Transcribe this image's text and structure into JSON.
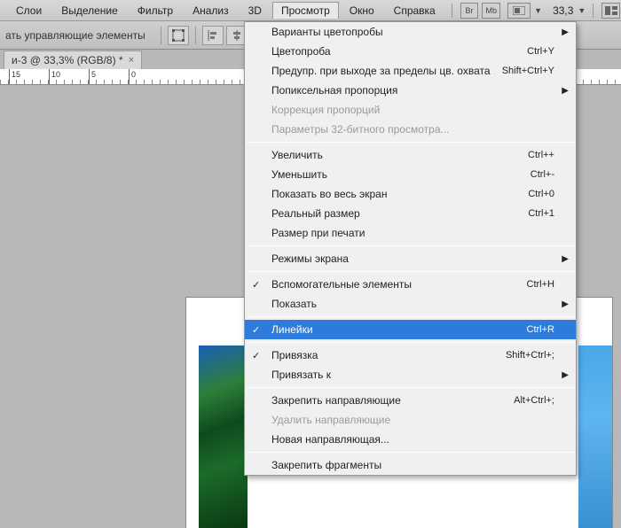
{
  "menubar": {
    "items": [
      "Слои",
      "Выделение",
      "Фильтр",
      "Анализ",
      "3D",
      "Просмотр",
      "Окно",
      "Справка"
    ],
    "open_index": 5,
    "icon_buttons": [
      "Br",
      "Mb"
    ],
    "zoom": "33,3"
  },
  "toolbar": {
    "label": "ать управляющие элементы"
  },
  "tab": {
    "title": "и-3 @ 33,3% (RGB/8) *"
  },
  "ruler": {
    "marks": [
      "15",
      "10",
      "5",
      "0"
    ]
  },
  "dropdown": {
    "groups": [
      [
        {
          "label": "Варианты цветопробы",
          "submenu": true
        },
        {
          "label": "Цветопроба",
          "shortcut": "Ctrl+Y"
        },
        {
          "label": "Предупр. при выходе за пределы цв. охвата",
          "shortcut": "Shift+Ctrl+Y"
        },
        {
          "label": "Попиксельная пропорция",
          "submenu": true
        },
        {
          "label": "Коррекция пропорций",
          "disabled": true
        },
        {
          "label": "Параметры 32-битного просмотра...",
          "disabled": true
        }
      ],
      [
        {
          "label": "Увеличить",
          "shortcut": "Ctrl++"
        },
        {
          "label": "Уменьшить",
          "shortcut": "Ctrl+-"
        },
        {
          "label": "Показать во весь экран",
          "shortcut": "Ctrl+0"
        },
        {
          "label": "Реальный размер",
          "shortcut": "Ctrl+1"
        },
        {
          "label": "Размер при печати"
        }
      ],
      [
        {
          "label": "Режимы экрана",
          "submenu": true
        }
      ],
      [
        {
          "label": "Вспомогательные элементы",
          "shortcut": "Ctrl+H",
          "checked": true
        },
        {
          "label": "Показать",
          "submenu": true
        }
      ],
      [
        {
          "label": "Линейки",
          "shortcut": "Ctrl+R",
          "checked": true,
          "highlight": true
        }
      ],
      [
        {
          "label": "Привязка",
          "shortcut": "Shift+Ctrl+;",
          "checked": true
        },
        {
          "label": "Привязать к",
          "submenu": true
        }
      ],
      [
        {
          "label": "Закрепить направляющие",
          "shortcut": "Alt+Ctrl+;"
        },
        {
          "label": "Удалить направляющие",
          "disabled": true
        },
        {
          "label": "Новая направляющая..."
        }
      ],
      [
        {
          "label": "Закрепить фрагменты"
        }
      ]
    ]
  }
}
